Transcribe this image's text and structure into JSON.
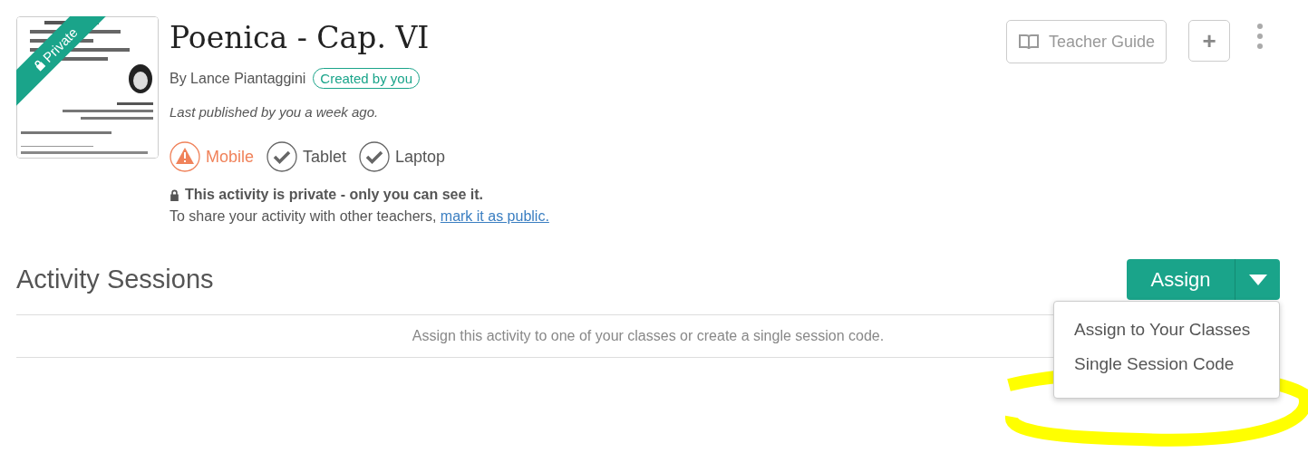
{
  "activity": {
    "ribbon": "Private",
    "title": "Poenica - Cap. VI",
    "author": "By Lance Piantaggini",
    "author_badge": "Created by you",
    "published": "Last published by you a week ago.",
    "devices": [
      {
        "label": "Mobile",
        "warning": true
      },
      {
        "label": "Tablet",
        "warning": false
      },
      {
        "label": "Laptop",
        "warning": false
      }
    ],
    "privacy": {
      "heading": "This activity is private - only you can see it.",
      "text": "To share your activity with other teachers,",
      "link": "mark it as public."
    }
  },
  "header_actions": {
    "guide": "Teacher Guide",
    "add": "+"
  },
  "sessions": {
    "title": "Activity Sessions",
    "assign": "Assign",
    "empty": "Assign this activity to one of your classes or create a single session code.",
    "menu": {
      "open": true,
      "items": [
        "Assign to Your Classes",
        "Single Session Code"
      ]
    }
  }
}
